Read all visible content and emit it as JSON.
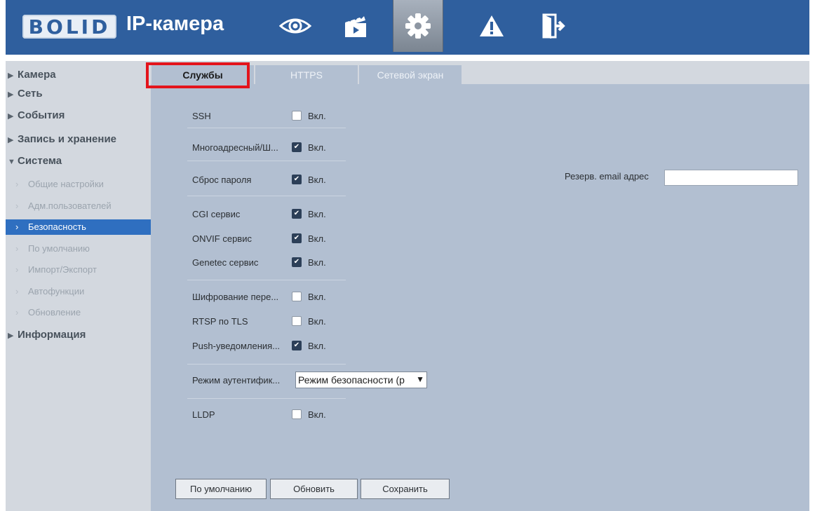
{
  "header": {
    "logo_text": "BOLID",
    "app_title": "IP-камера",
    "nav_icons": [
      "eye-icon",
      "clapperboard-icon",
      "gear-icon",
      "warning-icon",
      "logout-icon"
    ],
    "active_nav": "gear-icon"
  },
  "sidebar": {
    "top_items": {
      "camera": "Камера",
      "network": "Сеть",
      "events": "События",
      "storage": "Запись и хранение",
      "system": "Система",
      "info": "Информация"
    },
    "system_items": [
      {
        "label": "Общие настройки",
        "active": false
      },
      {
        "label": "Адм.пользователей",
        "active": false
      },
      {
        "label": "Безопасность",
        "active": true
      },
      {
        "label": "По умолчанию",
        "active": false
      },
      {
        "label": "Импорт/Экспорт",
        "active": false
      },
      {
        "label": "Автофункции",
        "active": false
      },
      {
        "label": "Обновление",
        "active": false
      }
    ]
  },
  "tabs": [
    {
      "label": "Службы",
      "active": true
    },
    {
      "label": "HTTPS",
      "active": false
    },
    {
      "label": "Сетевой экран",
      "active": false
    }
  ],
  "settings": {
    "on_label": "Вкл.",
    "rows": [
      {
        "label": "SSH",
        "checked": false
      },
      {
        "label": "Многоадресный/Ш...",
        "checked": true
      },
      {
        "label": "Сброс пароля",
        "checked": true
      },
      {
        "label": "CGI сервис",
        "checked": true
      },
      {
        "label": "ONVIF сервис",
        "checked": true
      },
      {
        "label": "Genetec сервис",
        "checked": true
      },
      {
        "label": "Шифрование пере...",
        "checked": false
      },
      {
        "label": "RTSP по TLS",
        "checked": false
      },
      {
        "label": "Push-уведомления...",
        "checked": true
      },
      {
        "label": "LLDP",
        "checked": false
      }
    ],
    "auth_mode": {
      "label": "Режим аутентифик...",
      "value": "Режим безопасности (р"
    },
    "backup_email": {
      "label": "Резерв. email адрес",
      "value": ""
    }
  },
  "buttons": {
    "default": "По умолчанию",
    "refresh": "Обновить",
    "save": "Сохранить"
  },
  "colors": {
    "header_bg": "#2f5f9e",
    "content_bg": "#b2bfd1",
    "sidebar_bg": "#d3d8df",
    "active_item": "#2f6fc0",
    "highlight": "#e3141c"
  }
}
